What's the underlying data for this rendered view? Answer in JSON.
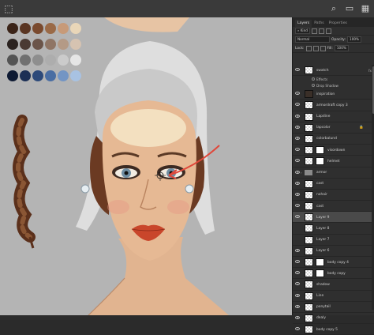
{
  "app": {
    "tabs": [
      "Layers",
      "Paths",
      "Properties"
    ],
    "active_tab": "Layers"
  },
  "layer_controls": {
    "kind_label": "Kind",
    "blend_mode": "Normal",
    "opacity_label": "Opacity:",
    "opacity_value": "100%",
    "lock_label": "Lock:",
    "fill_label": "Fill:",
    "fill_value": "100%"
  },
  "layers": [
    {
      "name": "swatch",
      "type": "pixel",
      "visible": true,
      "fx": true
    },
    {
      "name": "Effects",
      "type": "effects-header",
      "visible": true
    },
    {
      "name": "Drop Shadow",
      "type": "effect",
      "visible": true
    },
    {
      "name": "inspiration",
      "type": "pixel",
      "visible": true
    },
    {
      "name": "armordraft copy 3",
      "type": "pixel",
      "visible": true
    },
    {
      "name": "Lapdine",
      "type": "pixel",
      "visible": true
    },
    {
      "name": "lapcolor",
      "type": "pixel",
      "visible": true,
      "locked": true
    },
    {
      "name": "colorbalund",
      "type": "pixel",
      "visible": true
    },
    {
      "name": "visordown",
      "type": "pixel-mask",
      "visible": true
    },
    {
      "name": "helmet",
      "type": "pixel-mask",
      "visible": true
    },
    {
      "name": "armor",
      "type": "group",
      "visible": true
    },
    {
      "name": "cast",
      "type": "pixel",
      "visible": true
    },
    {
      "name": "nohair",
      "type": "pixel",
      "visible": true
    },
    {
      "name": "cast",
      "type": "pixel",
      "visible": true
    },
    {
      "name": "Layer 9",
      "type": "pixel",
      "visible": true,
      "selected": true
    },
    {
      "name": "Layer 8",
      "type": "pixel",
      "visible": false
    },
    {
      "name": "Layer 7",
      "type": "pixel",
      "visible": false
    },
    {
      "name": "Layer 6",
      "type": "pixel",
      "visible": true
    },
    {
      "name": "body copy 4",
      "type": "pixel-mask",
      "visible": true
    },
    {
      "name": "body copy",
      "type": "pixel-mask",
      "visible": true
    },
    {
      "name": "shadow",
      "type": "pixel",
      "visible": true
    },
    {
      "name": "Line",
      "type": "pixel",
      "visible": true
    },
    {
      "name": "ponytail",
      "type": "pixel",
      "visible": true
    },
    {
      "name": "dealy",
      "type": "pixel",
      "visible": true
    },
    {
      "name": "body copy 5",
      "type": "pixel",
      "visible": true
    }
  ],
  "colors": {
    "canvas_bg": "#b4b4b4",
    "panel_bg": "#2f2f2f",
    "selected_row": "#4a4a4a",
    "annotation_arrow": "#e0473a"
  },
  "swatches": [
    [
      "#3b2418",
      "#5a3522",
      "#7a4a2e",
      "#9a6a47",
      "#c79a78",
      "#e9d6b8"
    ],
    [
      "#2b2320",
      "#4a3a33",
      "#6b5449",
      "#8f7565",
      "#b49a86",
      "#d6c3b1"
    ],
    [
      "#545454",
      "#707070",
      "#8e8e8e",
      "#adadad",
      "#cbcbcb",
      "#e6e6e6"
    ],
    [
      "#0e1a33",
      "#1c2f55",
      "#2d4a7a",
      "#4a6ea3",
      "#7395c4",
      "#a8c2e2"
    ]
  ],
  "icons": [
    "marquee-tool-icon",
    "search-icon",
    "layout-icon",
    "layers-toggle-icon",
    "eye-icon",
    "folder-icon",
    "lock-icon",
    "fx-icon"
  ]
}
